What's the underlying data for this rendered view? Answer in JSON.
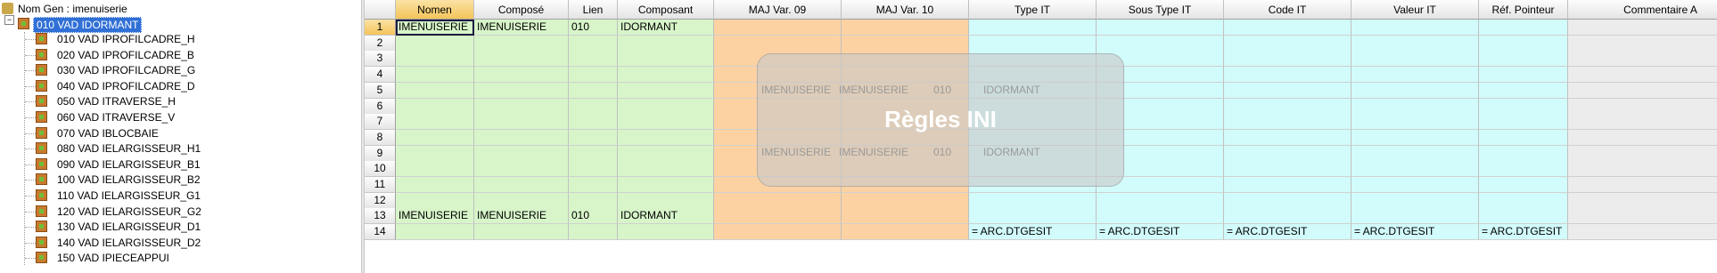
{
  "tree": {
    "root_label": "Nom Gen : imenuiserie",
    "expander": "−",
    "selected_label": "010 VAD IDORMANT",
    "items": [
      "010 VAD IPROFILCADRE_H",
      "020 VAD IPROFILCADRE_B",
      "030 VAD IPROFILCADRE_G",
      "040 VAD IPROFILCADRE_D",
      "050 VAD ITRAVERSE_H",
      "060 VAD ITRAVERSE_V",
      "070 VAD IBLOCBAIE",
      "080 VAD IELARGISSEUR_H1",
      "090 VAD IELARGISSEUR_B1",
      "100 VAD IELARGISSEUR_B2",
      "110 VAD IELARGISSEUR_G1",
      "120 VAD IELARGISSEUR_G2",
      "130 VAD IELARGISSEUR_D1",
      "140 VAD IELARGISSEUR_D2",
      "150 VAD IPIECEAPPUI"
    ]
  },
  "grid": {
    "columns": [
      "Nomen",
      "Composé",
      "Lien",
      "Composant",
      "MAJ Var. 09",
      "MAJ Var. 10",
      "Type IT",
      "Sous Type IT",
      "Code IT",
      "Valeur IT",
      "Réf. Pointeur",
      "Commentaire A"
    ],
    "column_colors": [
      "green",
      "green",
      "green",
      "green",
      "orange",
      "orange",
      "cyan",
      "cyan",
      "cyan",
      "cyan",
      "cyan",
      "grey"
    ],
    "row_numbers": [
      "1",
      "2",
      "3",
      "4",
      "5",
      "6",
      "7",
      "8",
      "9",
      "10",
      "11",
      "12",
      "13",
      "14"
    ],
    "rows": [
      [
        "IMENUISERIE",
        "IMENUISERIE",
        "010",
        "IDORMANT",
        "",
        "",
        "",
        "",
        "",
        "",
        "",
        ""
      ],
      [
        "",
        "",
        "",
        "",
        "",
        "",
        "",
        "",
        "",
        "",
        "",
        ""
      ],
      [
        "",
        "",
        "",
        "",
        "",
        "",
        "",
        "",
        "",
        "",
        "",
        ""
      ],
      [
        "",
        "",
        "",
        "",
        "",
        "",
        "",
        "",
        "",
        "",
        "",
        ""
      ],
      [
        "",
        "",
        "",
        "",
        "",
        "",
        "",
        "",
        "",
        "",
        "",
        ""
      ],
      [
        "",
        "",
        "",
        "",
        "",
        "",
        "",
        "",
        "",
        "",
        "",
        ""
      ],
      [
        "",
        "",
        "",
        "",
        "",
        "",
        "",
        "",
        "",
        "",
        "",
        ""
      ],
      [
        "",
        "",
        "",
        "",
        "",
        "",
        "",
        "",
        "",
        "",
        "",
        ""
      ],
      [
        "",
        "",
        "",
        "",
        "",
        "",
        "",
        "",
        "",
        "",
        "",
        ""
      ],
      [
        "",
        "",
        "",
        "",
        "",
        "",
        "",
        "",
        "",
        "",
        "",
        ""
      ],
      [
        "",
        "",
        "",
        "",
        "",
        "",
        "",
        "",
        "",
        "",
        "",
        ""
      ],
      [
        "",
        "",
        "",
        "",
        "",
        "",
        "",
        "",
        "",
        "",
        "",
        ""
      ],
      [
        "IMENUISERIE",
        "IMENUISERIE",
        "010",
        "IDORMANT",
        "",
        "",
        "",
        "",
        "",
        "",
        "",
        ""
      ],
      [
        "",
        "",
        "",
        "",
        "",
        "",
        "= ARC.DTGESIT",
        "= ARC.DTGESIT",
        "= ARC.DTGESIT",
        "= ARC.DTGESIT",
        "= ARC.DTGESIT",
        ""
      ]
    ],
    "active_row": 0,
    "active_col": 0
  },
  "overlay": {
    "title": "Règles INI",
    "ghost_rows": [
      [
        "IMENUISERIE",
        "IMENUISERIE",
        "010",
        "IDORMANT"
      ],
      [
        "IMENUISERIE",
        "IMENUISERIE",
        "010",
        "IDORMANT"
      ]
    ]
  }
}
